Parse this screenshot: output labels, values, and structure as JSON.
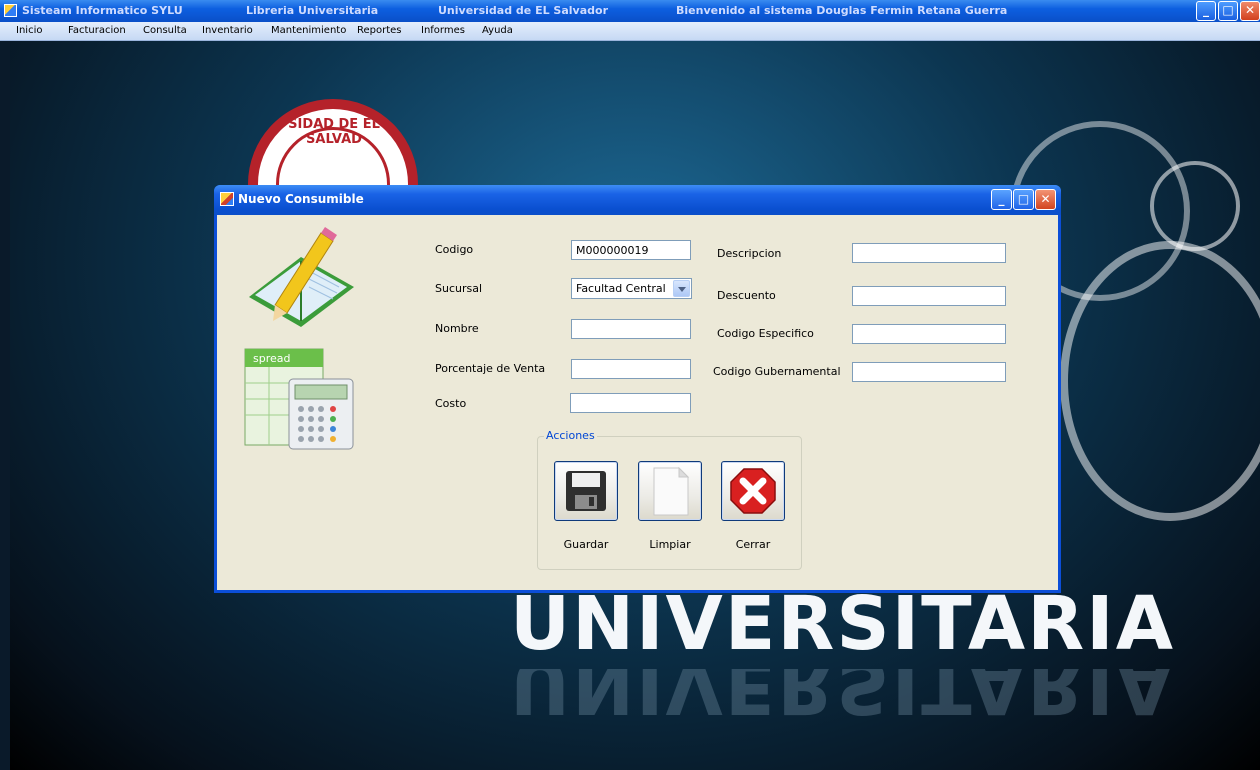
{
  "window": {
    "title_app": "Sisteam Informatico SYLU",
    "title_store": "Libreria Universitaria",
    "title_university": "Universidad de EL Salvador",
    "title_welcome": "Bienvenido al sistema Douglas Fermin Retana Guerra",
    "minimize_label": "_",
    "maximize_label": "□",
    "close_label": "✕"
  },
  "menu": {
    "items": [
      "Inicio",
      "Facturacion",
      "Consulta",
      "Inventario",
      "Mantenimiento",
      "Reportes",
      "Informes",
      "Ayuda"
    ]
  },
  "background": {
    "watermark_text": "UNIVERSITARIA",
    "seal_text": "SIDAD DE EL SALVAD"
  },
  "dialog": {
    "title": "Nuevo Consumible",
    "minimize_label": "_",
    "maximize_label": "□",
    "close_label": "✕",
    "fields": {
      "codigo_label": "Codigo",
      "codigo_value": "M000000019",
      "sucursal_label": "Sucursal",
      "sucursal_value": "Facultad Central",
      "nombre_label": "Nombre",
      "nombre_value": "",
      "porcentaje_label": "Porcentaje de Venta",
      "porcentaje_value": "",
      "costo_label": "Costo",
      "costo_value": "",
      "descripcion_label": "Descripcion",
      "descripcion_value": "",
      "descuento_label": "Descuento",
      "descuento_value": "",
      "codigo_especifico_label": "Codigo Especifico",
      "codigo_especifico_value": "",
      "codigo_gubernamental_label": "Codigo Gubernamental",
      "codigo_gubernamental_value": ""
    },
    "actions": {
      "group_label": "Acciones",
      "save_label": "Guardar",
      "clear_label": "Limpiar",
      "close_label": "Cerrar"
    },
    "spread_icon_text": "spread"
  }
}
